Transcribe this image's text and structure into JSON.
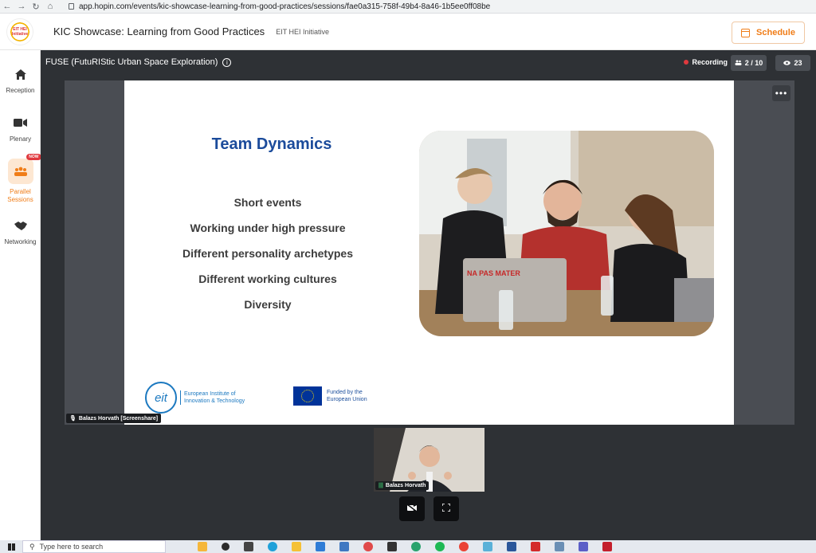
{
  "browser": {
    "url": "app.hopin.com/events/kic-showcase-learning-from-good-practices/sessions/fae0a315-758f-49b4-8a46-1b5ee0ff08be"
  },
  "header": {
    "logo_text": "EIT HEI Initiative",
    "event_title": "KIC Showcase: Learning from Good Practices",
    "organizer": "EIT HEI Initiative",
    "schedule_label": "Schedule",
    "accent_color": "#f07d18"
  },
  "sidebar": {
    "items": [
      {
        "label": "Reception",
        "icon": "home-icon"
      },
      {
        "label": "Plenary",
        "icon": "video-camera-icon"
      },
      {
        "label": "Parallel Sessions",
        "icon": "group-icon",
        "badge": "NOW",
        "active": true
      },
      {
        "label": "Networking",
        "icon": "handshake-icon"
      }
    ]
  },
  "stage": {
    "session_title": "FUSE (FutuRIStic Urban Space Exploration)",
    "recording_label": "Recording",
    "participants": "2 / 10",
    "viewers": "23"
  },
  "slide": {
    "title": "Team Dynamics",
    "bullets": [
      "Short events",
      "Working under high pressure",
      "Different personality archetypes",
      "Different working cultures",
      "Diversity"
    ],
    "eit_logo_text": "eit",
    "eit_org_line1": "European Institute of",
    "eit_org_line2": "Innovation & Technology",
    "eu_line1": "Funded by the",
    "eu_line2": "European Union",
    "laptop_sticker": "NA PAS MATER"
  },
  "screenshare": {
    "presenter_label": "Balazs Horvath [Screenshare]"
  },
  "camera": {
    "name_label": "Balazs Horvath"
  },
  "taskbar": {
    "search_placeholder": "Type here to search"
  }
}
